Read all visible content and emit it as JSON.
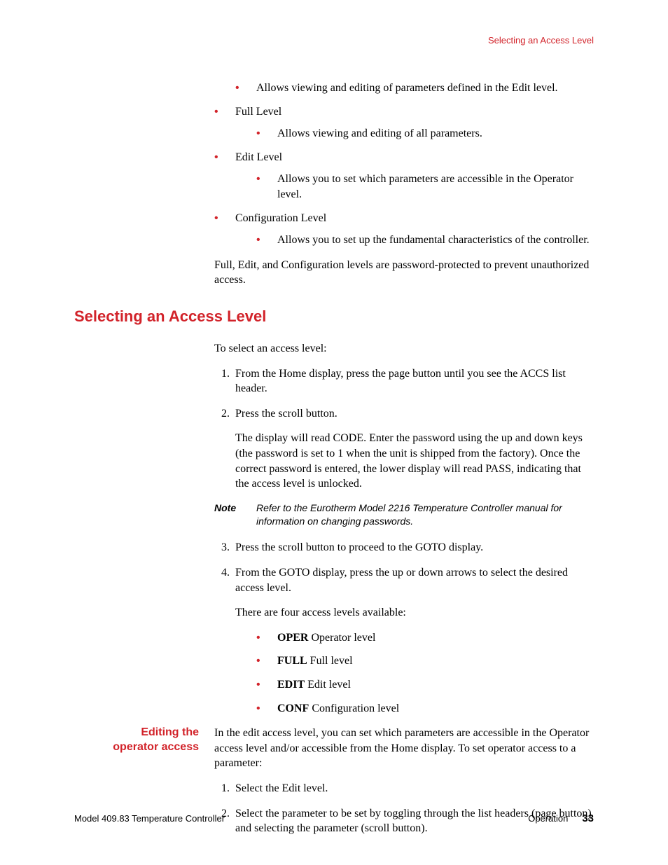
{
  "running_head": "Selecting an Access Level",
  "levels_top": {
    "pre_sub": "Allows viewing and editing of parameters defined in the Edit level.",
    "items": [
      {
        "label": "Full Level",
        "sub": "Allows viewing and editing of all parameters."
      },
      {
        "label": "Edit Level",
        "sub": "Allows you to set which parameters are accessible in the Operator level."
      },
      {
        "label": "Configuration Level",
        "sub": "Allows you to set up the fundamental characteristics of the controller."
      }
    ],
    "tail": "Full, Edit, and Configuration levels are password-protected to prevent unauthorized access."
  },
  "section_title": "Selecting an Access Level",
  "intro": "To select an access level:",
  "steps": [
    {
      "text": "From the Home display, press the page button until you see the ACCS list header."
    },
    {
      "text": "Press the scroll button.",
      "follow": "The display will read CODE. Enter the password using the up and down keys (the password is set to 1 when the unit is shipped from the factory). Once the correct password is entered, the lower display will read PASS, indicating that the access level is unlocked."
    },
    {
      "text": "Press the scroll button to proceed to the GOTO display."
    },
    {
      "text": "From the GOTO display, press the up or down arrows to select the desired access level.",
      "follow": "There are four access levels available:"
    }
  ],
  "note": {
    "label": "Note",
    "text": "Refer to the Eurotherm Model 2216 Temperature Controller manual for information on changing passwords."
  },
  "codes": [
    {
      "code": "OPER",
      "desc": " Operator level"
    },
    {
      "code": "FULL",
      "desc": " Full level"
    },
    {
      "code": "EDIT",
      "desc": " Edit level"
    },
    {
      "code": "CONF",
      "desc": " Configuration level"
    }
  ],
  "subsection": {
    "label_line1": "Editing the",
    "label_line2": "operator access",
    "intro": "In the edit access level, you can set which parameters are accessible in the Operator access level and/or accessible from the Home display. To set operator access to a parameter:",
    "steps": [
      "Select the Edit level.",
      "Select the parameter to be set by toggling through the list headers (page button) and selecting the parameter (scroll button)."
    ]
  },
  "footer": {
    "left": "Model 409.83 Temperature Controller",
    "right_label": "Operation",
    "page": "33"
  }
}
